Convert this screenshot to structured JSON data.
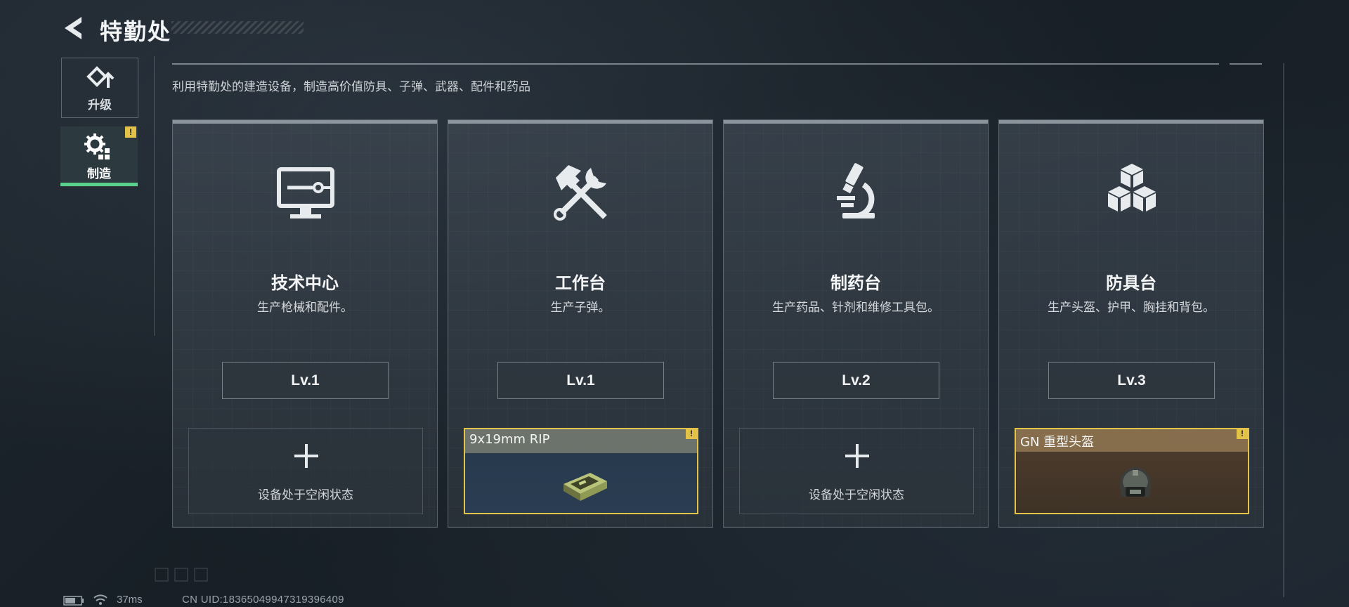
{
  "header": {
    "title": "特勤处",
    "back_icon": "back-arrow-icon"
  },
  "nav": {
    "tabs": [
      {
        "label": "升级",
        "icon": "upgrade-icon",
        "active": false
      },
      {
        "label": "制造",
        "icon": "craft-gear-icon",
        "active": true,
        "alert": "!"
      }
    ]
  },
  "subtitle": "利用特勤处的建造设备，制造高价值防具、子弹、武器、配件和药品",
  "colors": {
    "accent_green": "#59d08c",
    "alert_yellow": "#e4c24a"
  },
  "stations": [
    {
      "name": "技术中心",
      "desc": "生产枪械和配件。",
      "level": "Lv.1",
      "icon": "monitor-icon",
      "slot": {
        "state": "idle",
        "text": "设备处于空闲状态"
      }
    },
    {
      "name": "工作台",
      "desc": "生产子弹。",
      "level": "Lv.1",
      "icon": "hammer-wrench-icon",
      "slot": {
        "state": "item",
        "item_name": "9x19mm RIP",
        "alert": "!",
        "item_icon": "ammo-box-icon"
      }
    },
    {
      "name": "制药台",
      "desc": "生产药品、针剂和维修工具包。",
      "level": "Lv.2",
      "icon": "microscope-icon",
      "slot": {
        "state": "idle",
        "text": "设备处于空闲状态"
      }
    },
    {
      "name": "防具台",
      "desc": "生产头盔、护甲、胸挂和背包。",
      "level": "Lv.3",
      "icon": "cubes-icon",
      "slot": {
        "state": "item",
        "item_name": "GN 重型头盔",
        "alert": "!",
        "item_icon": "helmet-icon"
      }
    }
  ],
  "footer": {
    "ping": "37ms",
    "uid": "CN UID:18365049947319396409"
  }
}
